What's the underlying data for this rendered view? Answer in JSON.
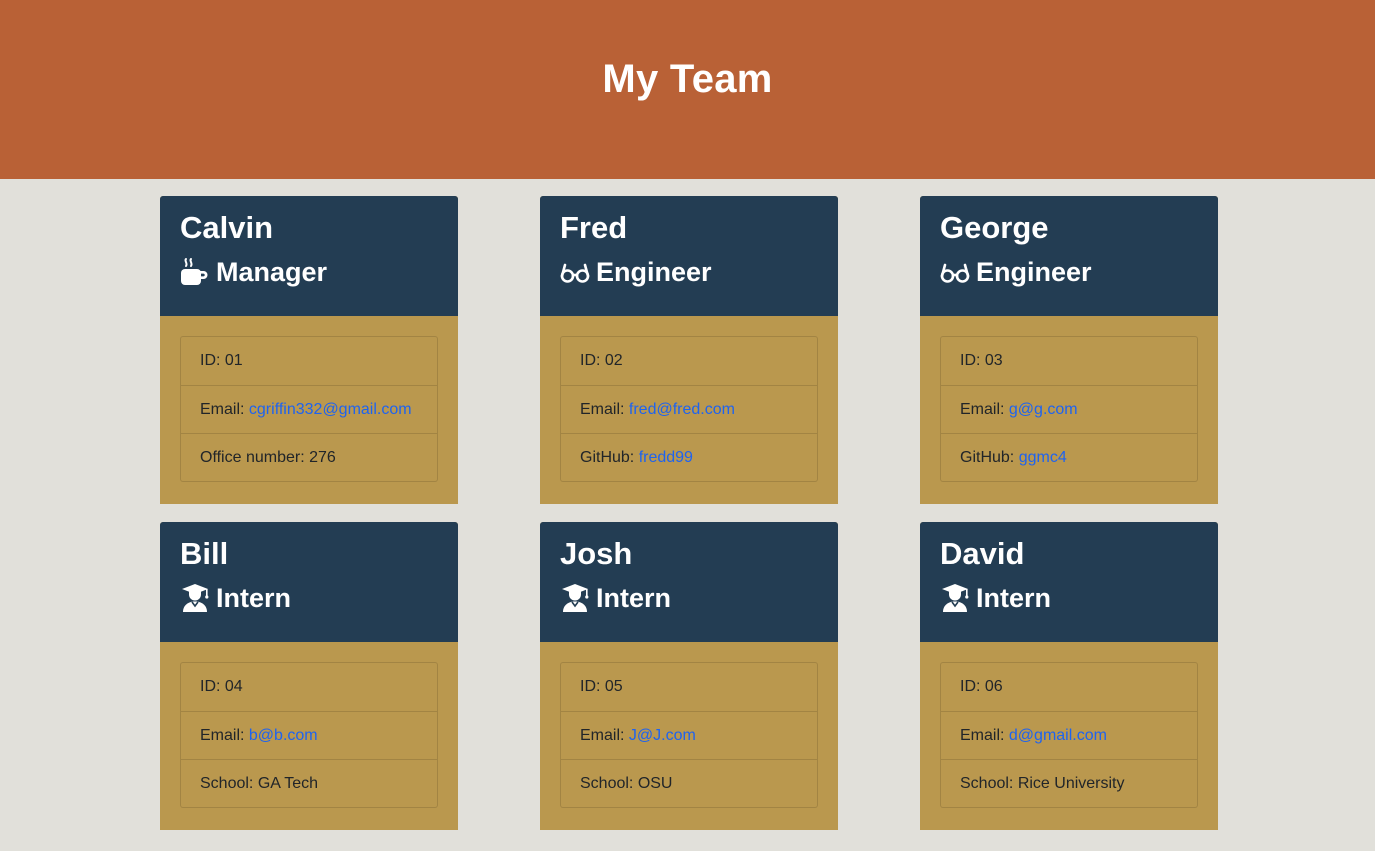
{
  "header": {
    "title": "My Team"
  },
  "employees": [
    {
      "name": "Calvin",
      "role": "Manager",
      "icon": "coffee-icon",
      "id_label": "ID: ",
      "id": "01",
      "email_label": "Email: ",
      "email": "cgriffin332@gmail.com",
      "extra_label": "Office number: ",
      "extra": "276",
      "extra_is_link": false
    },
    {
      "name": "Fred",
      "role": "Engineer",
      "icon": "glasses-icon",
      "id_label": "ID: ",
      "id": "02",
      "email_label": "Email: ",
      "email": "fred@fred.com",
      "extra_label": "GitHub: ",
      "extra": "fredd99",
      "extra_is_link": true
    },
    {
      "name": "George",
      "role": "Engineer",
      "icon": "glasses-icon",
      "id_label": "ID: ",
      "id": "03",
      "email_label": "Email: ",
      "email": "g@g.com",
      "extra_label": "GitHub: ",
      "extra": "ggmc4",
      "extra_is_link": true
    },
    {
      "name": "Bill",
      "role": "Intern",
      "icon": "graduate-icon",
      "id_label": "ID: ",
      "id": "04",
      "email_label": "Email: ",
      "email": "b@b.com",
      "extra_label": "School: ",
      "extra": "GA Tech",
      "extra_is_link": false
    },
    {
      "name": "Josh",
      "role": "Intern",
      "icon": "graduate-icon",
      "id_label": "ID: ",
      "id": "05",
      "email_label": "Email: ",
      "email": "J@J.com",
      "extra_label": "School: ",
      "extra": "OSU",
      "extra_is_link": false
    },
    {
      "name": "David",
      "role": "Intern",
      "icon": "graduate-icon",
      "id_label": "ID: ",
      "id": "06",
      "email_label": "Email: ",
      "email": "d@gmail.com",
      "extra_label": "School: ",
      "extra": "Rice University",
      "extra_is_link": false
    }
  ],
  "colors": {
    "banner": "#b96136",
    "page_background": "#e1e0da",
    "card_header": "#233d53",
    "card_body": "#ba984e",
    "link": "#1e63f0"
  }
}
